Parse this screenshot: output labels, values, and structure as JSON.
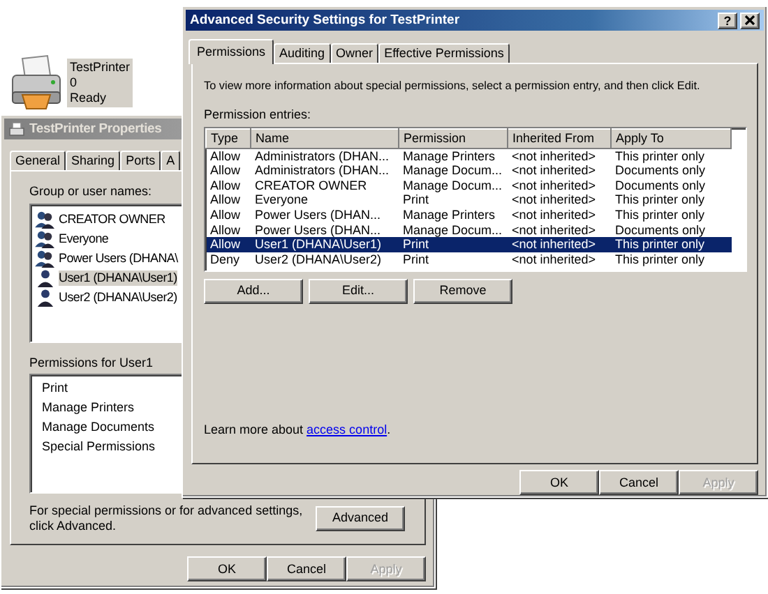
{
  "desktop_printer": {
    "name": "TestPrinter",
    "jobs": "0",
    "status": "Ready"
  },
  "properties_window": {
    "title": "TestPrinter Properties",
    "tabs": [
      "General",
      "Sharing",
      "Ports",
      "A"
    ],
    "group_label": "Group or user names:",
    "users": [
      {
        "name": "CREATOR OWNER",
        "kind": "group",
        "selected": false
      },
      {
        "name": "Everyone",
        "kind": "group",
        "selected": false
      },
      {
        "name": "Power Users (DHANA\\",
        "kind": "group",
        "selected": false
      },
      {
        "name": "User1 (DHANA\\User1)",
        "kind": "user",
        "selected": true
      },
      {
        "name": "User2 (DHANA\\User2)",
        "kind": "user",
        "selected": false
      }
    ],
    "permissions_label": "Permissions for User1",
    "permissions": [
      "Print",
      "Manage Printers",
      "Manage Documents",
      "Special Permissions"
    ],
    "advanced_note": "For special permissions or for advanced settings, click Advanced.",
    "advanced_button": "Advanced",
    "buttons": [
      {
        "label": "OK",
        "disabled": false
      },
      {
        "label": "Cancel",
        "disabled": false
      },
      {
        "label": "Apply",
        "disabled": true
      }
    ]
  },
  "advanced_window": {
    "title": "Advanced Security Settings for TestPrinter",
    "help_button": "?",
    "tabs": [
      {
        "label": "Permissions",
        "selected": true
      },
      {
        "label": "Auditing",
        "selected": false
      },
      {
        "label": "Owner",
        "selected": false
      },
      {
        "label": "Effective Permissions",
        "selected": false
      }
    ],
    "intro": "To view more information about special permissions, select a permission entry, and then click Edit.",
    "entries_label": "Permission entries:",
    "columns": [
      "Type",
      "Name",
      "Permission",
      "Inherited From",
      "Apply To"
    ],
    "rows": [
      {
        "type": "Allow",
        "name": "Administrators (DHAN...",
        "permission": "Manage Printers",
        "inherited_from": "<not inherited>",
        "apply_to": "This printer only",
        "selected": false
      },
      {
        "type": "Allow",
        "name": "Administrators (DHAN...",
        "permission": "Manage Docum...",
        "inherited_from": "<not inherited>",
        "apply_to": "Documents only",
        "selected": false
      },
      {
        "type": "Allow",
        "name": "CREATOR OWNER",
        "permission": "Manage Docum...",
        "inherited_from": "<not inherited>",
        "apply_to": "Documents only",
        "selected": false
      },
      {
        "type": "Allow",
        "name": "Everyone",
        "permission": "Print",
        "inherited_from": "<not inherited>",
        "apply_to": "This printer only",
        "selected": false
      },
      {
        "type": "Allow",
        "name": "Power Users (DHAN...",
        "permission": "Manage Printers",
        "inherited_from": "<not inherited>",
        "apply_to": "This printer only",
        "selected": false
      },
      {
        "type": "Allow",
        "name": "Power Users (DHAN...",
        "permission": "Manage Docum...",
        "inherited_from": "<not inherited>",
        "apply_to": "Documents only",
        "selected": false
      },
      {
        "type": "Allow",
        "name": "User1 (DHANA\\User1)",
        "permission": "Print",
        "inherited_from": "<not inherited>",
        "apply_to": "This printer only",
        "selected": true
      },
      {
        "type": "Deny",
        "name": "User2 (DHANA\\User2)",
        "permission": "Print",
        "inherited_from": "<not inherited>",
        "apply_to": "This printer only",
        "selected": false
      }
    ],
    "entry_buttons": [
      "Add...",
      "Edit...",
      "Remove"
    ],
    "learn_more": {
      "text": "Learn more about ",
      "link": "access control",
      "end": "."
    },
    "buttons": [
      {
        "label": "OK",
        "disabled": false
      },
      {
        "label": "Cancel",
        "disabled": false
      },
      {
        "label": "Apply",
        "disabled": true
      }
    ]
  }
}
